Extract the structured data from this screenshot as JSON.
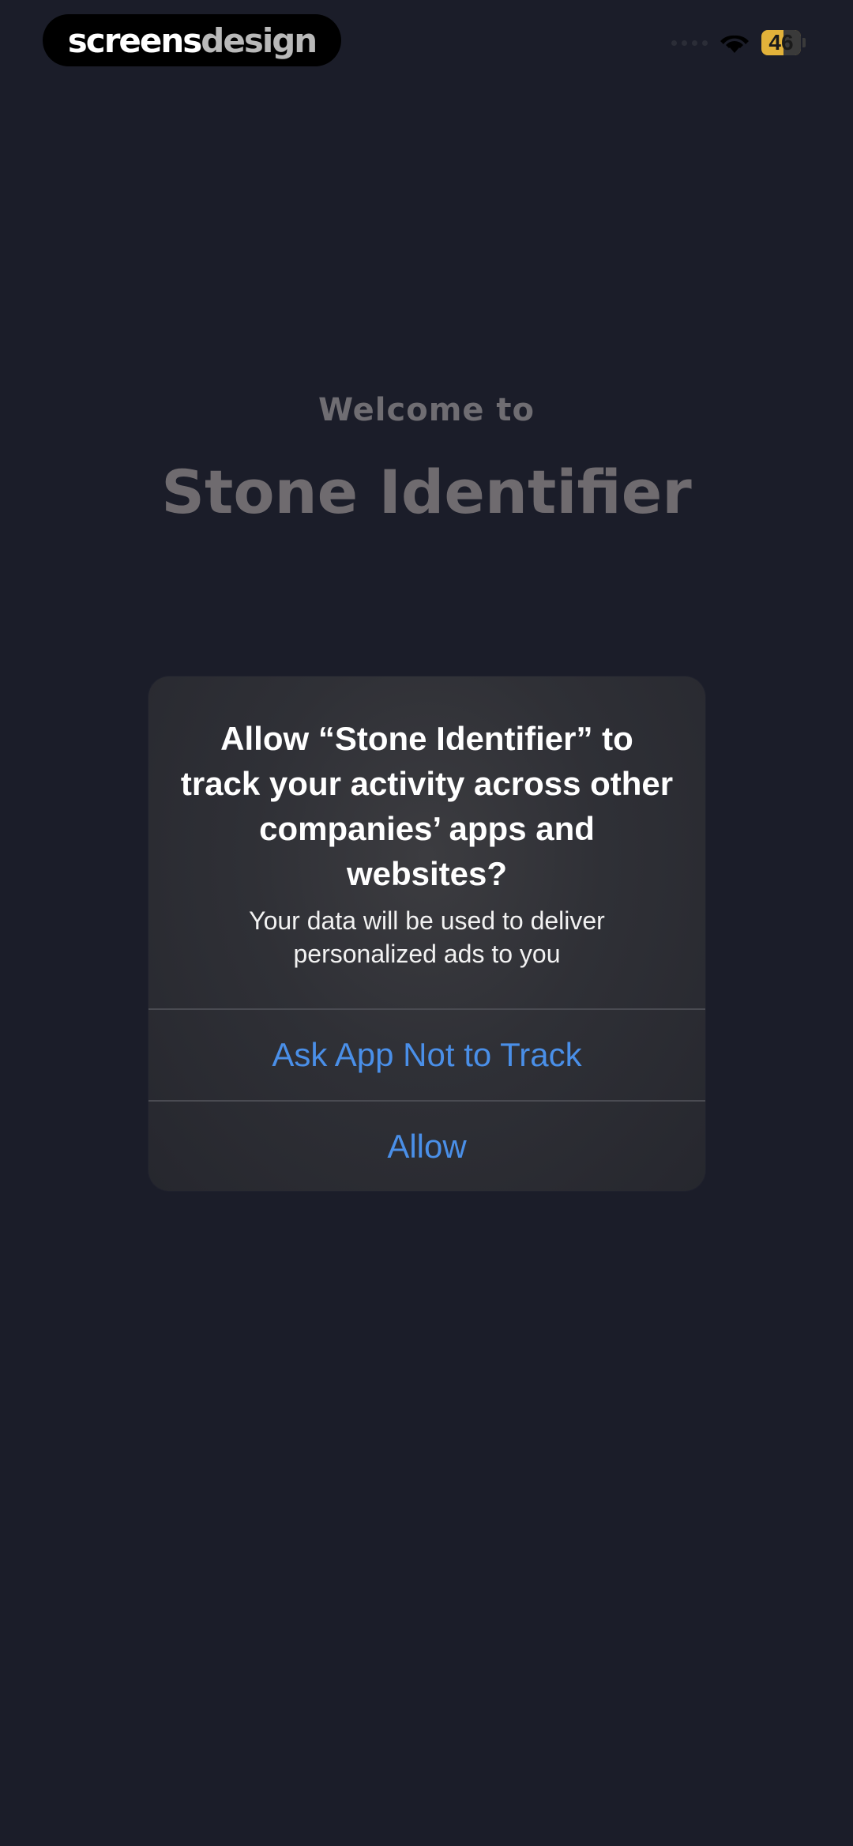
{
  "watermark": {
    "part1": "screens",
    "part2": "design"
  },
  "status_bar": {
    "battery_level": "46",
    "icons": [
      "signal-dots-icon",
      "wifi-icon",
      "battery-icon"
    ]
  },
  "welcome": {
    "subtitle": "Welcome to",
    "title": "Stone Identifier"
  },
  "alert": {
    "title": "Allow “Stone Identifier” to track your activity across other companies’ apps and websites?",
    "message": "Your data will be used to deliver personalized ads to you",
    "buttons": [
      {
        "label": "Ask App Not to Track"
      },
      {
        "label": "Allow"
      }
    ]
  },
  "colors": {
    "background": "#1b1d29",
    "accent": "#4a8fe8",
    "battery": "#e2b23a"
  }
}
